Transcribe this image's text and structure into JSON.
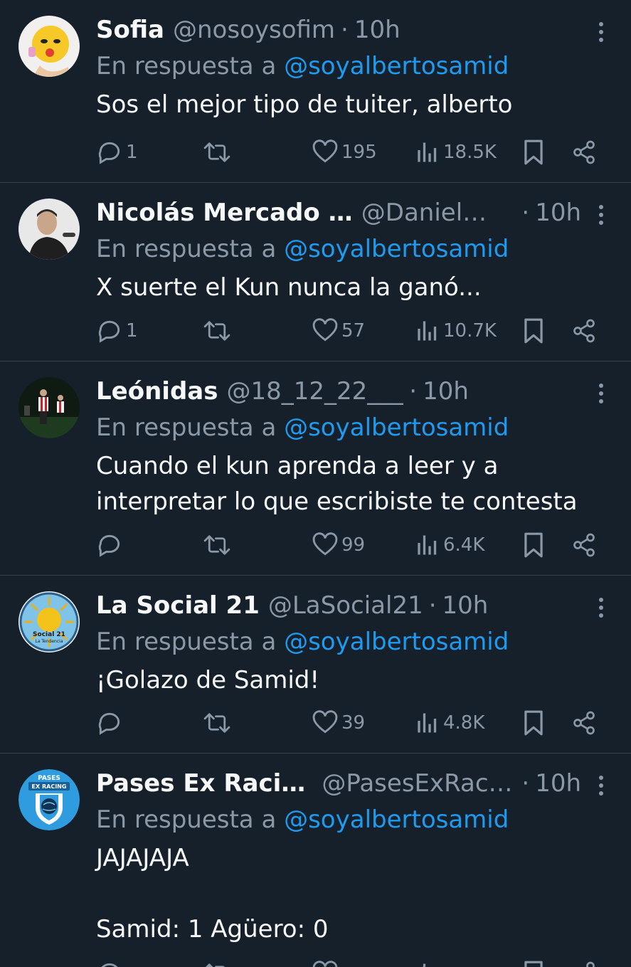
{
  "tweets": [
    {
      "name": "Sofia",
      "handle": "@nosoysofim",
      "sep": "·",
      "time": "10h",
      "reply_prefix": "En respuesta a ",
      "reply_to": "@soyalbertosamid",
      "text": "Sos el mejor tipo de tuiter, alberto",
      "replies": "1",
      "retweets": "",
      "likes": "195",
      "views": "18.5K",
      "avatar_icon": "emoji-avatar"
    },
    {
      "name": "Nicolás Mercado ...",
      "handle": "@DanielM...",
      "sep": "·",
      "time": "10h",
      "reply_prefix": "En respuesta a ",
      "reply_to": "@soyalbertosamid",
      "text": "X suerte el Kun nunca la ganó...",
      "replies": "1",
      "retweets": "",
      "likes": "57",
      "views": "10.7K",
      "avatar_icon": "person-avatar"
    },
    {
      "name": "Leónidas",
      "handle": "@18_12_22___",
      "sep": "·",
      "time": "10h",
      "reply_prefix": "En respuesta a ",
      "reply_to": "@soyalbertosamid",
      "text": "Cuando el kun aprenda a leer y a\ninterpretar lo que escribiste te contesta",
      "replies": "",
      "retweets": "",
      "likes": "99",
      "views": "6.4K",
      "avatar_icon": "football-players-avatar"
    },
    {
      "name": "La Social 21",
      "handle": "@LaSocial21",
      "sep": "·",
      "time": "10h",
      "reply_prefix": "En respuesta a ",
      "reply_to": "@soyalbertosamid",
      "text": "¡Golazo de Samid!",
      "replies": "",
      "retweets": "",
      "likes": "39",
      "views": "4.8K",
      "avatar_icon": "sun-logo-avatar",
      "avatar_text": [
        "Social 21",
        "La Tendencia"
      ]
    },
    {
      "name": "Pases Ex Racing",
      "handle": "@PasesExRaci...",
      "sep": "·",
      "time": "10h",
      "reply_prefix": "En respuesta a ",
      "reply_to": "@soyalbertosamid",
      "text": "JAJAJAJA\n\nSamid: 1 Agüero: 0",
      "replies": "",
      "retweets": "",
      "likes": "",
      "views": "",
      "avatar_icon": "racing-logo-avatar",
      "avatar_text": [
        "PASES",
        "EX RACING"
      ]
    }
  ],
  "colors": {
    "background": "#15202b",
    "secondary_text": "#8b98a5",
    "link": "#1d9bf0",
    "divider": "#38444d"
  }
}
